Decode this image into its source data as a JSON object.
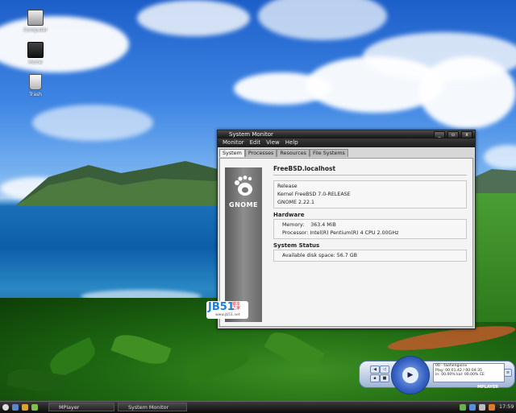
{
  "desktop": {
    "icons": [
      {
        "label": "Computer",
        "icon": "computer-icon"
      },
      {
        "label": "Home",
        "icon": "home-folder-icon"
      },
      {
        "label": "Trash",
        "icon": "trash-icon"
      }
    ]
  },
  "window": {
    "title": "System Monitor",
    "controls": [
      "_",
      "▫",
      "x"
    ],
    "menu": [
      "Monitor",
      "Edit",
      "View",
      "Help"
    ],
    "tabs": [
      "System",
      "Processes",
      "Resources",
      "File Systems"
    ],
    "active_tab": "System",
    "logo_text": "GNOME",
    "hostname": "FreeBSD.localhost",
    "release": {
      "label": "Release",
      "kernel": "Kernel FreeBSD 7.0-RELEASE",
      "gnome": "GNOME 2.22.1"
    },
    "hardware": {
      "heading": "Hardware",
      "memory": "Memory:    363.4 MiB",
      "processor": "Processor: Intel(R) Pentium(R) 4 CPU 2.00GHz"
    },
    "status": {
      "heading": "System Status",
      "disk": "Available disk space: 56.7 GB"
    }
  },
  "watermark": {
    "logo": "JB51",
    "cn": "脚本\n之家",
    "url": "www.jb51.net"
  },
  "mplayer": {
    "line1": "00 - taohengxinx",
    "line2": "Play: 00:01:42 / 00:04:35",
    "line3": "in: 00.00%  kal: 00.00%  CE",
    "brand": "MPLAYER"
  },
  "taskbar": {
    "tasks": [
      "MPlayer",
      "System Monitor"
    ],
    "clock": "17:59"
  }
}
